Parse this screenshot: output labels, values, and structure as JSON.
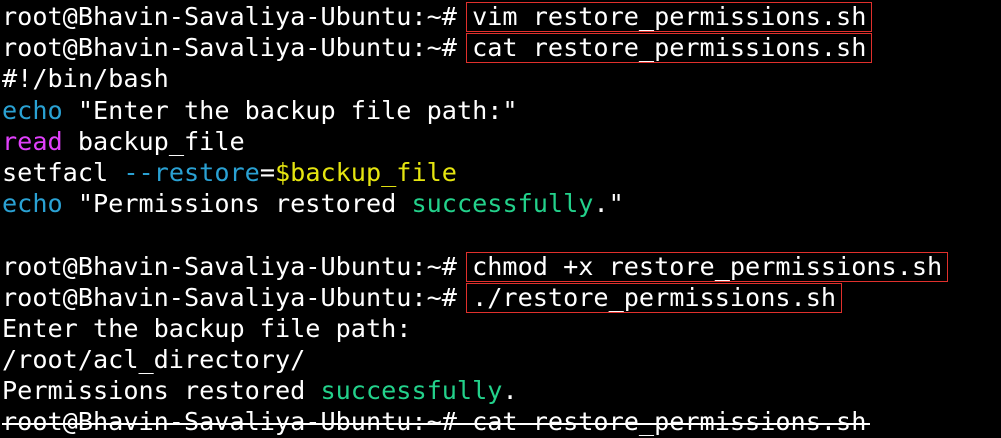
{
  "terminal": {
    "prompt": "root@Bhavin-Savaliya-Ubuntu:~# ",
    "colors": {
      "background": "#000000",
      "text": "#ffffff",
      "builtin": "#2aa1d3",
      "read_keyword": "#e040fb",
      "option": "#2aa1d3",
      "variable": "#e5e510",
      "success_word": "#23d18b",
      "highlight_box": "#e0302c"
    },
    "lines": [
      {
        "type": "prompt",
        "command": "vim restore_permissions.sh",
        "highlighted": true
      },
      {
        "type": "prompt",
        "command": "cat restore_permissions.sh",
        "highlighted": true
      },
      {
        "type": "script",
        "segments": [
          {
            "text": "#!/bin/bash",
            "color": "#ffffff"
          }
        ]
      },
      {
        "type": "script",
        "segments": [
          {
            "text": "echo",
            "color": "#2aa1d3"
          },
          {
            "text": " \"Enter the backup file path:\"",
            "color": "#ffffff"
          }
        ]
      },
      {
        "type": "script",
        "segments": [
          {
            "text": "read",
            "color": "#e040fb"
          },
          {
            "text": " backup_file",
            "color": "#ffffff"
          }
        ]
      },
      {
        "type": "script",
        "segments": [
          {
            "text": "setfacl ",
            "color": "#ffffff"
          },
          {
            "text": "--restore",
            "color": "#2aa1d3"
          },
          {
            "text": "=",
            "color": "#ffffff"
          },
          {
            "text": "$backup_file",
            "color": "#e5e510"
          }
        ]
      },
      {
        "type": "script",
        "segments": [
          {
            "text": "echo",
            "color": "#2aa1d3"
          },
          {
            "text": " \"Permissions restored ",
            "color": "#ffffff"
          },
          {
            "text": "successfully",
            "color": "#23d18b"
          },
          {
            "text": ".\"",
            "color": "#ffffff"
          }
        ]
      },
      {
        "type": "blank"
      },
      {
        "type": "prompt",
        "command": "chmod +x restore_permissions.sh",
        "highlighted": true
      },
      {
        "type": "prompt",
        "command": "./restore_permissions.sh",
        "highlighted": true
      },
      {
        "type": "output",
        "segments": [
          {
            "text": "Enter the backup file path:",
            "color": "#ffffff"
          }
        ]
      },
      {
        "type": "output",
        "segments": [
          {
            "text": "/root/acl_directory/",
            "color": "#ffffff"
          }
        ]
      },
      {
        "type": "output",
        "segments": [
          {
            "text": "Permissions restored ",
            "color": "#ffffff"
          },
          {
            "text": "successfully",
            "color": "#23d18b"
          },
          {
            "text": ".",
            "color": "#ffffff"
          }
        ]
      },
      {
        "type": "prompt",
        "command": "cat restore_permissions.sh",
        "highlighted": false,
        "struck": true
      }
    ]
  }
}
